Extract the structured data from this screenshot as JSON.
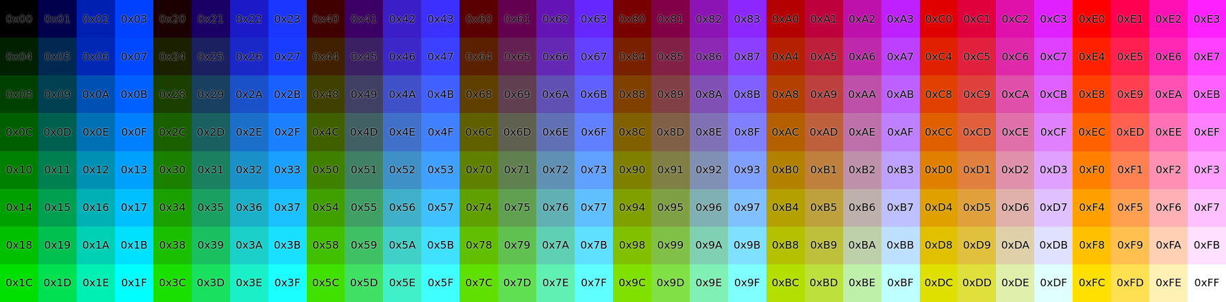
{
  "cells": [
    [
      {
        "label": "0x00",
        "color": "#000000"
      },
      {
        "label": "0x01",
        "color": "#00004C"
      },
      {
        "label": "0x02",
        "color": "#0020B2"
      },
      {
        "label": "0x03",
        "color": "#0040FF"
      },
      {
        "label": "0x20",
        "color": "#1A0000"
      },
      {
        "label": "0x21",
        "color": "#1A0064"
      },
      {
        "label": "0x22",
        "color": "#1A1AC8"
      },
      {
        "label": "0x23",
        "color": "#1A36FF"
      },
      {
        "label": "0x40",
        "color": "#400000"
      },
      {
        "label": "0x41",
        "color": "#3C0064"
      },
      {
        "label": "0x42",
        "color": "#3C1EC8"
      },
      {
        "label": "0x43",
        "color": "#3C30FF"
      },
      {
        "label": "0x60",
        "color": "#5A0000"
      },
      {
        "label": "0x61",
        "color": "#640050"
      },
      {
        "label": "0x62",
        "color": "#6414B4"
      },
      {
        "label": "0x63",
        "color": "#6428FF"
      },
      {
        "label": "0x80",
        "color": "#780000"
      },
      {
        "label": "0x81",
        "color": "#820046"
      },
      {
        "label": "0x82",
        "color": "#8C14B4"
      },
      {
        "label": "0x83",
        "color": "#8C28FF"
      },
      {
        "label": "0xA0",
        "color": "#B40000"
      },
      {
        "label": "0xA1",
        "color": "#BE003C"
      },
      {
        "label": "0xA2",
        "color": "#BE10AA"
      },
      {
        "label": "0xA3",
        "color": "#BE20FF"
      },
      {
        "label": "0xC0",
        "color": "#E00000"
      },
      {
        "label": "0xC1",
        "color": "#E0003C"
      },
      {
        "label": "0xC2",
        "color": "#E010AA"
      },
      {
        "label": "0xC3",
        "color": "#E020FF"
      },
      {
        "label": "0xE0",
        "color": "#FF0000"
      },
      {
        "label": "0xE1",
        "color": "#FF0050"
      },
      {
        "label": "0xE2",
        "color": "#FF10B4"
      },
      {
        "label": "0xE3",
        "color": "#FF20FF"
      }
    ],
    [
      {
        "label": "0x04",
        "color": "#002000"
      },
      {
        "label": "0x05",
        "color": "#002850"
      },
      {
        "label": "0x06",
        "color": "#0028B4"
      },
      {
        "label": "0x07",
        "color": "#0048FF"
      },
      {
        "label": "0x24",
        "color": "#1A2000"
      },
      {
        "label": "0x25",
        "color": "#1A2060"
      },
      {
        "label": "0x26",
        "color": "#1A28C8"
      },
      {
        "label": "0x27",
        "color": "#1A3CFF"
      },
      {
        "label": "0x44",
        "color": "#402000"
      },
      {
        "label": "0x45",
        "color": "#3C2064"
      },
      {
        "label": "0x46",
        "color": "#3C28C8"
      },
      {
        "label": "0x47",
        "color": "#3C40FF"
      },
      {
        "label": "0x64",
        "color": "#5A2000"
      },
      {
        "label": "0x65",
        "color": "#642050"
      },
      {
        "label": "0x66",
        "color": "#6428B4"
      },
      {
        "label": "0x67",
        "color": "#6440FF"
      },
      {
        "label": "0x84",
        "color": "#782000"
      },
      {
        "label": "0x85",
        "color": "#822046"
      },
      {
        "label": "0x86",
        "color": "#8C28B4"
      },
      {
        "label": "0x87",
        "color": "#8C40FF"
      },
      {
        "label": "0xA4",
        "color": "#B42000"
      },
      {
        "label": "0xA5",
        "color": "#BE203C"
      },
      {
        "label": "0xA6",
        "color": "#BE28AA"
      },
      {
        "label": "0xA7",
        "color": "#BE40FF"
      },
      {
        "label": "0xC4",
        "color": "#E02000"
      },
      {
        "label": "0xC5",
        "color": "#E0203C"
      },
      {
        "label": "0xC6",
        "color": "#E028AA"
      },
      {
        "label": "0xC7",
        "color": "#E040FF"
      },
      {
        "label": "0xE4",
        "color": "#FF2000"
      },
      {
        "label": "0xE5",
        "color": "#FF2050"
      },
      {
        "label": "0xE6",
        "color": "#FF28B4"
      },
      {
        "label": "0xE7",
        "color": "#FF40FF"
      }
    ],
    [
      {
        "label": "0x08",
        "color": "#004000"
      },
      {
        "label": "0x09",
        "color": "#004050"
      },
      {
        "label": "0x0A",
        "color": "#0050B4"
      },
      {
        "label": "0x0B",
        "color": "#0060FF"
      },
      {
        "label": "0x28",
        "color": "#1A4000"
      },
      {
        "label": "0x29",
        "color": "#1A4060"
      },
      {
        "label": "0x2A",
        "color": "#1A50C8"
      },
      {
        "label": "0x2B",
        "color": "#1A60FF"
      },
      {
        "label": "0x48",
        "color": "#404000"
      },
      {
        "label": "0x49",
        "color": "#404064"
      },
      {
        "label": "0x4A",
        "color": "#4050C8"
      },
      {
        "label": "0x4B",
        "color": "#4060FF"
      },
      {
        "label": "0x68",
        "color": "#604000"
      },
      {
        "label": "0x69",
        "color": "#604050"
      },
      {
        "label": "0x6A",
        "color": "#6050B4"
      },
      {
        "label": "0x6B",
        "color": "#6060FF"
      },
      {
        "label": "0x88",
        "color": "#804000"
      },
      {
        "label": "0x89",
        "color": "#804046"
      },
      {
        "label": "0x8A",
        "color": "#8050B4"
      },
      {
        "label": "0x8B",
        "color": "#8060FF"
      },
      {
        "label": "0xA8",
        "color": "#B44000"
      },
      {
        "label": "0xA9",
        "color": "#BE403C"
      },
      {
        "label": "0xAA",
        "color": "#BE50AA"
      },
      {
        "label": "0xAB",
        "color": "#BE60FF"
      },
      {
        "label": "0xC8",
        "color": "#E04000"
      },
      {
        "label": "0xC9",
        "color": "#E0403C"
      },
      {
        "label": "0xCA",
        "color": "#E050AA"
      },
      {
        "label": "0xCB",
        "color": "#E060FF"
      },
      {
        "label": "0xE8",
        "color": "#FF4000"
      },
      {
        "label": "0xE9",
        "color": "#FF4050"
      },
      {
        "label": "0xEA",
        "color": "#FF50B4"
      },
      {
        "label": "0xEB",
        "color": "#FF60FF"
      }
    ],
    [
      {
        "label": "0x0C",
        "color": "#006000"
      },
      {
        "label": "0x0D",
        "color": "#006050"
      },
      {
        "label": "0x0E",
        "color": "#0070B4"
      },
      {
        "label": "0x0F",
        "color": "#0080FF"
      },
      {
        "label": "0x2C",
        "color": "#1A6000"
      },
      {
        "label": "0x2D",
        "color": "#1A6060"
      },
      {
        "label": "0x2E",
        "color": "#1A70C8"
      },
      {
        "label": "0x2F",
        "color": "#1A80FF"
      },
      {
        "label": "0x4C",
        "color": "#406000"
      },
      {
        "label": "0x4D",
        "color": "#406064"
      },
      {
        "label": "0x4E",
        "color": "#4070C8"
      },
      {
        "label": "0x4F",
        "color": "#4080FF"
      },
      {
        "label": "0x6C",
        "color": "#606000"
      },
      {
        "label": "0x6D",
        "color": "#606050"
      },
      {
        "label": "0x6E",
        "color": "#6070B4"
      },
      {
        "label": "0x6F",
        "color": "#6080FF"
      },
      {
        "label": "0x8C",
        "color": "#806000"
      },
      {
        "label": "0x8D",
        "color": "#806046"
      },
      {
        "label": "0x8E",
        "color": "#8070B4"
      },
      {
        "label": "0x8F",
        "color": "#8080FF"
      },
      {
        "label": "0xAC",
        "color": "#B46000"
      },
      {
        "label": "0xAD",
        "color": "#BE603C"
      },
      {
        "label": "0xAE",
        "color": "#BE70AA"
      },
      {
        "label": "0xAF",
        "color": "#BE80FF"
      },
      {
        "label": "0xCC",
        "color": "#E06000"
      },
      {
        "label": "0xCD",
        "color": "#E0603C"
      },
      {
        "label": "0xCE",
        "color": "#E070AA"
      },
      {
        "label": "0xCF",
        "color": "#E080FF"
      },
      {
        "label": "0xEC",
        "color": "#FF6000"
      },
      {
        "label": "0xED",
        "color": "#FF6050"
      },
      {
        "label": "0xEE",
        "color": "#FF70B4"
      },
      {
        "label": "0xEF",
        "color": "#FF80FF"
      }
    ],
    [
      {
        "label": "0x10",
        "color": "#008000"
      },
      {
        "label": "0x11",
        "color": "#008050"
      },
      {
        "label": "0x12",
        "color": "#0090B4"
      },
      {
        "label": "0x13",
        "color": "#00A0FF"
      },
      {
        "label": "0x30",
        "color": "#1A8000"
      },
      {
        "label": "0x31",
        "color": "#1A8060"
      },
      {
        "label": "0x32",
        "color": "#1A90C8"
      },
      {
        "label": "0x33",
        "color": "#1AA0FF"
      },
      {
        "label": "0x50",
        "color": "#408000"
      },
      {
        "label": "0x51",
        "color": "#408064"
      },
      {
        "label": "0x52",
        "color": "#4090C8"
      },
      {
        "label": "0x53",
        "color": "#40A0FF"
      },
      {
        "label": "0x70",
        "color": "#608000"
      },
      {
        "label": "0x71",
        "color": "#608050"
      },
      {
        "label": "0x72",
        "color": "#6090B4"
      },
      {
        "label": "0x73",
        "color": "#60A0FF"
      },
      {
        "label": "0x90",
        "color": "#808000"
      },
      {
        "label": "0x91",
        "color": "#808046"
      },
      {
        "label": "0x92",
        "color": "#8090B4"
      },
      {
        "label": "0x93",
        "color": "#80A0FF"
      },
      {
        "label": "0xB0",
        "color": "#B48000"
      },
      {
        "label": "0xB1",
        "color": "#BE803C"
      },
      {
        "label": "0xB2",
        "color": "#BE90AA"
      },
      {
        "label": "0xB3",
        "color": "#BEA0FF"
      },
      {
        "label": "0xD0",
        "color": "#E08000"
      },
      {
        "label": "0xD1",
        "color": "#E0803C"
      },
      {
        "label": "0xD2",
        "color": "#E090AA"
      },
      {
        "label": "0xD3",
        "color": "#E0A0FF"
      },
      {
        "label": "0xF0",
        "color": "#FF8000"
      },
      {
        "label": "0xF1",
        "color": "#FF8050"
      },
      {
        "label": "0xF2",
        "color": "#FF90B4"
      },
      {
        "label": "0xF3",
        "color": "#FFA0FF"
      }
    ],
    [
      {
        "label": "0x14",
        "color": "#00A000"
      },
      {
        "label": "0x15",
        "color": "#00A050"
      },
      {
        "label": "0x16",
        "color": "#00B0B4"
      },
      {
        "label": "0x17",
        "color": "#00C0FF"
      },
      {
        "label": "0x34",
        "color": "#1AA000"
      },
      {
        "label": "0x35",
        "color": "#1AA060"
      },
      {
        "label": "0x36",
        "color": "#1AB0C8"
      },
      {
        "label": "0x37",
        "color": "#1AC0FF"
      },
      {
        "label": "0x54",
        "color": "#40A000"
      },
      {
        "label": "0x55",
        "color": "#40A064"
      },
      {
        "label": "0x56",
        "color": "#40B0C8"
      },
      {
        "label": "0x57",
        "color": "#40C0FF"
      },
      {
        "label": "0x74",
        "color": "#60A000"
      },
      {
        "label": "0x75",
        "color": "#60A050"
      },
      {
        "label": "0x76",
        "color": "#60B0B4"
      },
      {
        "label": "0x77",
        "color": "#60C0FF"
      },
      {
        "label": "0x94",
        "color": "#80A000"
      },
      {
        "label": "0x95",
        "color": "#80A046"
      },
      {
        "label": "0x96",
        "color": "#80B0B4"
      },
      {
        "label": "0x97",
        "color": "#80C0FF"
      },
      {
        "label": "0xB4",
        "color": "#B4A000"
      },
      {
        "label": "0xB5",
        "color": "#BEA03C"
      },
      {
        "label": "0xB6",
        "color": "#BEB0AA"
      },
      {
        "label": "0xB7",
        "color": "#BEC0FF"
      },
      {
        "label": "0xD4",
        "color": "#E0A000"
      },
      {
        "label": "0xD5",
        "color": "#E0A03C"
      },
      {
        "label": "0xD6",
        "color": "#E0B0AA"
      },
      {
        "label": "0xD7",
        "color": "#E0C0FF"
      },
      {
        "label": "0xF4",
        "color": "#FFA000"
      },
      {
        "label": "0xF5",
        "color": "#FFA050"
      },
      {
        "label": "0xF6",
        "color": "#FFB0B4"
      },
      {
        "label": "0xF7",
        "color": "#FFC0FF"
      }
    ],
    [
      {
        "label": "0x18",
        "color": "#00C000"
      },
      {
        "label": "0x19",
        "color": "#00C050"
      },
      {
        "label": "0x1A",
        "color": "#00D0B4"
      },
      {
        "label": "0x1B",
        "color": "#00E0FF"
      },
      {
        "label": "0x38",
        "color": "#1AC000"
      },
      {
        "label": "0x39",
        "color": "#1AC060"
      },
      {
        "label": "0x3A",
        "color": "#1AD0C8"
      },
      {
        "label": "0x3B",
        "color": "#1AE0FF"
      },
      {
        "label": "0x58",
        "color": "#40C000"
      },
      {
        "label": "0x59",
        "color": "#40C064"
      },
      {
        "label": "0x5A",
        "color": "#40D0C8"
      },
      {
        "label": "0x5B",
        "color": "#40E0FF"
      },
      {
        "label": "0x78",
        "color": "#60C000"
      },
      {
        "label": "0x79",
        "color": "#60C050"
      },
      {
        "label": "0x7A",
        "color": "#60D0B4"
      },
      {
        "label": "0x7B",
        "color": "#60E0FF"
      },
      {
        "label": "0x98",
        "color": "#80C000"
      },
      {
        "label": "0x99",
        "color": "#80C046"
      },
      {
        "label": "0x9A",
        "color": "#80D0B4"
      },
      {
        "label": "0x9B",
        "color": "#80E0FF"
      },
      {
        "label": "0xB8",
        "color": "#B4C000"
      },
      {
        "label": "0xB9",
        "color": "#BEC03C"
      },
      {
        "label": "0xBA",
        "color": "#BED0AA"
      },
      {
        "label": "0xBB",
        "color": "#BEE0FF"
      },
      {
        "label": "0xD8",
        "color": "#E0C000"
      },
      {
        "label": "0xD9",
        "color": "#E0C03C"
      },
      {
        "label": "0xDA",
        "color": "#E0D0AA"
      },
      {
        "label": "0xDB",
        "color": "#E0E0FF"
      },
      {
        "label": "0xF8",
        "color": "#FFC000"
      },
      {
        "label": "0xF9",
        "color": "#FFC050"
      },
      {
        "label": "0xFA",
        "color": "#FFD0B4"
      },
      {
        "label": "0xFB",
        "color": "#FFE0FF"
      }
    ],
    [
      {
        "label": "0x1C",
        "color": "#00E000"
      },
      {
        "label": "0x1D",
        "color": "#00E050"
      },
      {
        "label": "0x1E",
        "color": "#00F0B4"
      },
      {
        "label": "0x1F",
        "color": "#00FFFF"
      },
      {
        "label": "0x3C",
        "color": "#1AE000"
      },
      {
        "label": "0x3D",
        "color": "#1AE060"
      },
      {
        "label": "0x3E",
        "color": "#1AF0C8"
      },
      {
        "label": "0x3F",
        "color": "#1AFFFF"
      },
      {
        "label": "0x5C",
        "color": "#40E000"
      },
      {
        "label": "0x5D",
        "color": "#40E064"
      },
      {
        "label": "0x5E",
        "color": "#40F0C8"
      },
      {
        "label": "0x5F",
        "color": "#40FFFF"
      },
      {
        "label": "0x7C",
        "color": "#60E000"
      },
      {
        "label": "0x7D",
        "color": "#60E050"
      },
      {
        "label": "0x7E",
        "color": "#60F0B4"
      },
      {
        "label": "0x7F",
        "color": "#60FFFF"
      },
      {
        "label": "0x9C",
        "color": "#80E000"
      },
      {
        "label": "0x9D",
        "color": "#80E046"
      },
      {
        "label": "0x9E",
        "color": "#80F0B4"
      },
      {
        "label": "0x9F",
        "color": "#80FFFF"
      },
      {
        "label": "0xBC",
        "color": "#B4E000"
      },
      {
        "label": "0xBD",
        "color": "#BEE03C"
      },
      {
        "label": "0xBE",
        "color": "#BEF0AA"
      },
      {
        "label": "0xBF",
        "color": "#BEFFFF"
      },
      {
        "label": "0xDC",
        "color": "#E0E000"
      },
      {
        "label": "0xDD",
        "color": "#E0E03C"
      },
      {
        "label": "0xDE",
        "color": "#E0F0AA"
      },
      {
        "label": "0xDF",
        "color": "#E0FFFF"
      },
      {
        "label": "0xFC",
        "color": "#FFE000"
      },
      {
        "label": "0xFD",
        "color": "#FFE050"
      },
      {
        "label": "0xFE",
        "color": "#FFF0B4"
      },
      {
        "label": "0xFF",
        "color": "#FFFFFF"
      }
    ]
  ]
}
